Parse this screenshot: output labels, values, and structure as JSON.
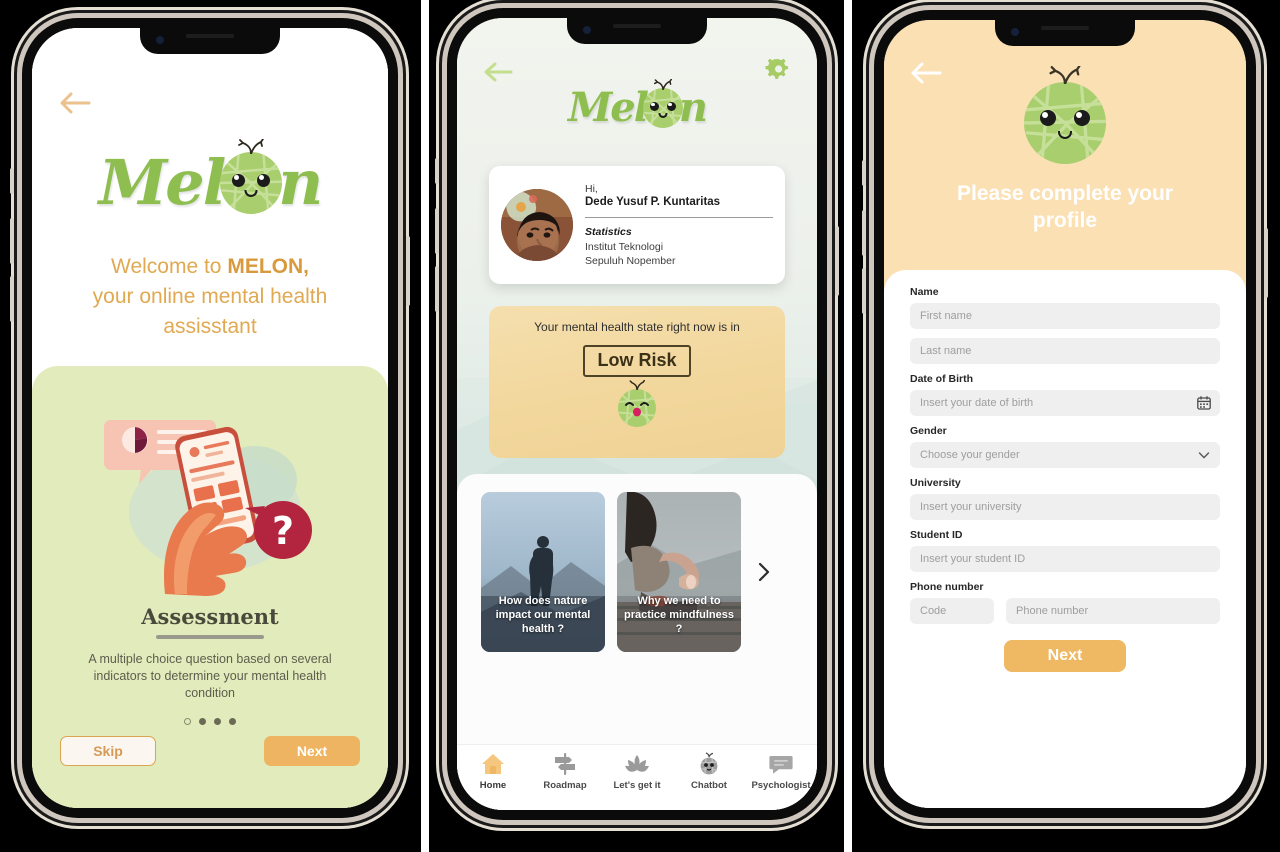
{
  "app": {
    "name": "MELON",
    "logo_text_left": "Mel",
    "logo_text_right": "n"
  },
  "screen1": {
    "back_icon": "back-arrow-icon",
    "welcome_line1_prefix": "Welcome to ",
    "welcome_brand": "MELON,",
    "welcome_line2": "your online mental health",
    "welcome_line3": "assisstant",
    "feature_title": "Assessment",
    "feature_description": "A multiple choice question based on several indicators to determine your mental health condition",
    "pagination": {
      "total": 4,
      "active_index": 0
    },
    "skip_label": "Skip",
    "next_label": "Next"
  },
  "screen2": {
    "back_icon": "back-arrow-icon",
    "settings_icon": "gear-icon",
    "profile": {
      "greeting": "Hi,",
      "name": "Dede Yusuf P. Kuntaritas",
      "major": "Statistics",
      "university_line1": "Institut Teknologi",
      "university_line2": "Sepuluh Nopember"
    },
    "risk": {
      "caption": "Your mental health state right now is in",
      "level": "Low Risk"
    },
    "articles": [
      {
        "title": "How does nature impact our mental health ?"
      },
      {
        "title": "Why we need to practice mindfulness ?"
      }
    ],
    "articles_next_icon": "chevron-right-icon",
    "tabs": [
      {
        "label": "Home",
        "icon": "home-icon",
        "active": true
      },
      {
        "label": "Roadmap",
        "icon": "signpost-icon",
        "active": false
      },
      {
        "label": "Let's get it",
        "icon": "lotus-icon",
        "active": false
      },
      {
        "label": "Chatbot",
        "icon": "melon-bot-icon",
        "active": false
      },
      {
        "label": "Psychologist",
        "icon": "chat-bubble-icon",
        "active": false
      }
    ]
  },
  "screen3": {
    "back_icon": "back-arrow-icon",
    "title": "Please complete your profile",
    "fields": [
      {
        "label": "Name",
        "placeholder": "First name",
        "value": "",
        "icon": ""
      },
      {
        "label": "",
        "placeholder": "Last name",
        "value": "",
        "icon": ""
      },
      {
        "label": "Date of Birth",
        "placeholder": "Insert your date of birth",
        "value": "",
        "icon": "calendar-icon"
      },
      {
        "label": "Gender",
        "placeholder": "Choose your gender",
        "value": "",
        "icon": "chevron-down-icon"
      },
      {
        "label": "University",
        "placeholder": "Insert your university",
        "value": "",
        "icon": ""
      },
      {
        "label": "Student ID",
        "placeholder": "Insert your student ID",
        "value": "",
        "icon": ""
      }
    ],
    "phone_label": "Phone number",
    "phone_code_placeholder": "Code",
    "phone_number_placeholder": "Phone number",
    "next_label": "Next"
  },
  "colors": {
    "brand_green": "#8EBE4F",
    "melon_body": "#A9CE6E",
    "accent_orange": "#EEB461",
    "card_green": "#E2EBBB",
    "header_tan": "#FBE0B4",
    "risk_card": "#F2D79C",
    "welcome_text": "#E1A951"
  }
}
